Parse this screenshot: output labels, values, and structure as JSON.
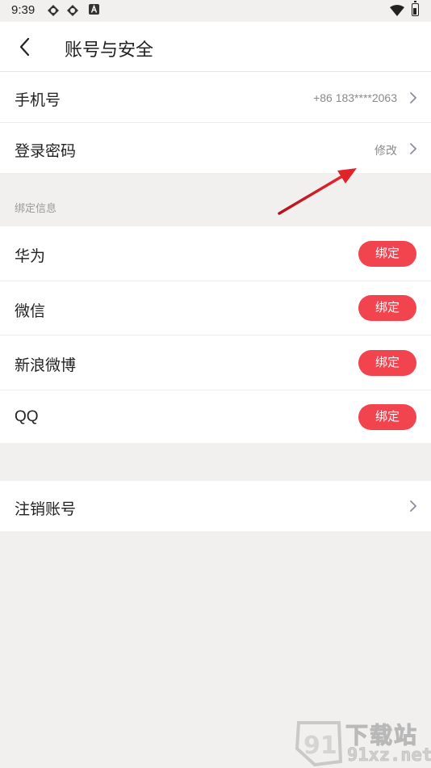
{
  "status_bar": {
    "time": "9:39"
  },
  "header": {
    "title": "账号与安全"
  },
  "account": {
    "phone_label": "手机号",
    "phone_value": "+86 183****2063",
    "password_label": "登录密码",
    "password_action": "修改"
  },
  "binding": {
    "section_title": "绑定信息",
    "items": [
      {
        "label": "华为",
        "button": "绑定"
      },
      {
        "label": "微信",
        "button": "绑定"
      },
      {
        "label": "新浪微博",
        "button": "绑定"
      },
      {
        "label": "QQ",
        "button": "绑定"
      }
    ]
  },
  "deactivate": {
    "label": "注销账号"
  },
  "watermark": {
    "brand": "下载站",
    "url": "91xz.net",
    "logo_text": "91"
  },
  "colors": {
    "accent": "#f2444e",
    "annotation_arrow": "#d8202a",
    "background": "#f1f0ef"
  }
}
